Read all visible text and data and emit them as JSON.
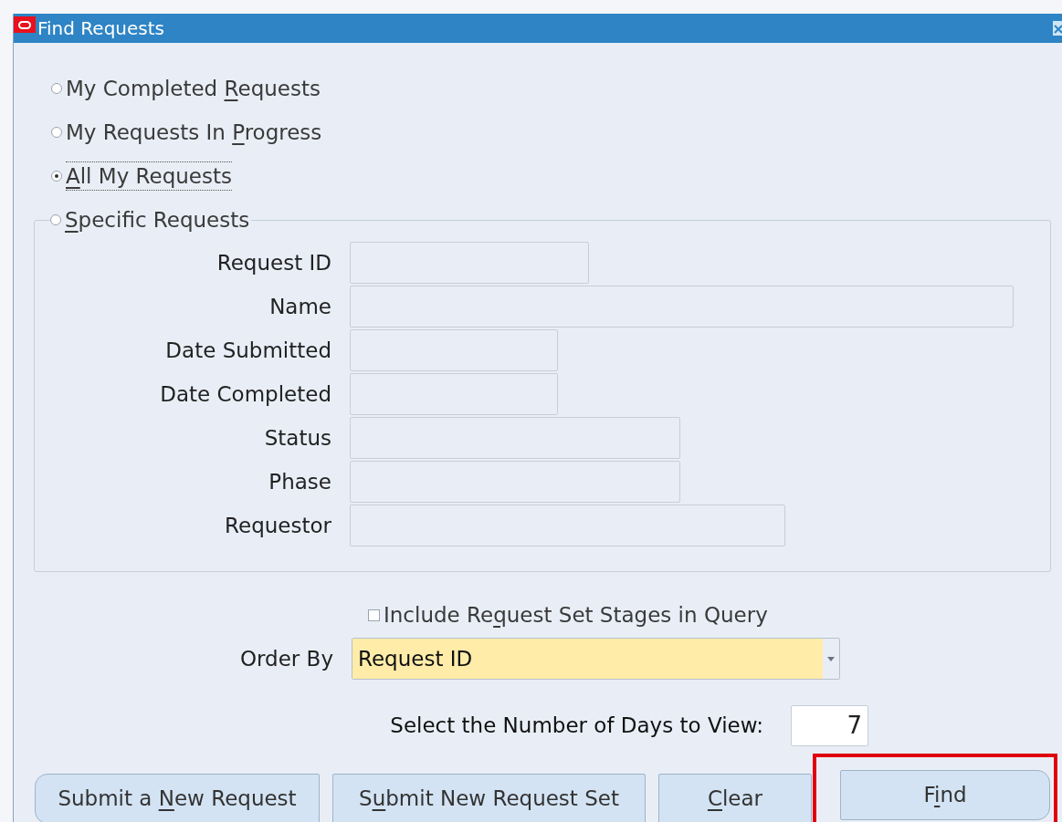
{
  "window": {
    "title": "Find Requests"
  },
  "options": [
    {
      "pre": "My Completed ",
      "key": "R",
      "post": "equests",
      "selected": false
    },
    {
      "pre": "My Requests In ",
      "key": "P",
      "post": "rogress",
      "selected": false
    },
    {
      "key": "A",
      "post": "ll My Requests",
      "selected": true
    },
    {
      "key": "S",
      "post": "pecific Requests",
      "selected": false
    }
  ],
  "fields": [
    {
      "label": "Request ID"
    },
    {
      "label": "Name"
    },
    {
      "label": "Date Submitted"
    },
    {
      "label": "Date Completed"
    },
    {
      "label": "Status"
    },
    {
      "label": "Phase"
    },
    {
      "label": "Requestor"
    }
  ],
  "include_stages": {
    "pre": "Include Re",
    "key": "q",
    "post": "uest Set Stages in Query",
    "checked": false
  },
  "order_by": {
    "label": "Order By",
    "value": "Request ID"
  },
  "days": {
    "label": "Select the Number of Days to View:",
    "value": "7"
  },
  "buttons": [
    {
      "pre": "Submit a ",
      "key": "N",
      "post": "ew Request",
      "highlighted": false
    },
    {
      "pre": "S",
      "key": "u",
      "post": "bmit New Request Set",
      "highlighted": false
    },
    {
      "key": "C",
      "post": "lear",
      "highlighted": false
    },
    {
      "pre": "F",
      "key": "i",
      "post": "nd",
      "highlighted": true
    }
  ]
}
